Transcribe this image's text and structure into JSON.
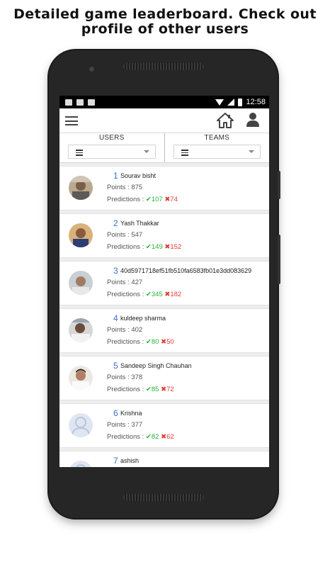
{
  "promo": {
    "line1": "Detailed game leaderboard. Check out",
    "line2": "profile of other users"
  },
  "statusbar": {
    "time": "12:58"
  },
  "filters": {
    "users_label": "USERS",
    "teams_label": "TEAMS"
  },
  "leaderboard": [
    {
      "rank": "1",
      "name": "Sourav bisht",
      "points": "Points : 875",
      "predictions_label": "Predictions :",
      "correct": "107",
      "wrong": "74",
      "avatar": "photo"
    },
    {
      "rank": "2",
      "name": "Yash Thakkar",
      "points": "Points : 547",
      "predictions_label": "Predictions :",
      "correct": "149",
      "wrong": "152",
      "avatar": "photo"
    },
    {
      "rank": "3",
      "name": "40d5971718ef51fb510fa6583fb01e3dd083629",
      "points": "Points : 427",
      "predictions_label": "Predictions :",
      "correct": "345",
      "wrong": "182",
      "avatar": "photo"
    },
    {
      "rank": "4",
      "name": "kuldeep sharma",
      "points": "Points : 402",
      "predictions_label": "Predictions :",
      "correct": "80",
      "wrong": "50",
      "avatar": "photo"
    },
    {
      "rank": "5",
      "name": "Sandeep Singh Chauhan",
      "points": "Points : 378",
      "predictions_label": "Predictions :",
      "correct": "85",
      "wrong": "72",
      "avatar": "photo"
    },
    {
      "rank": "6",
      "name": "Krishna",
      "points": "Points : 377",
      "predictions_label": "Predictions :",
      "correct": "82",
      "wrong": "62",
      "avatar": "placeholder"
    },
    {
      "rank": "7",
      "name": "ashish",
      "points": "",
      "predictions_label": "",
      "correct": "",
      "wrong": "",
      "avatar": "placeholder"
    }
  ],
  "icons": {
    "menu": "hamburger-icon",
    "home": "home-icon",
    "profile": "user-icon",
    "correct": "check-icon",
    "wrong": "cross-icon"
  },
  "colors": {
    "rank": "#3a6fd1",
    "correct": "#27b23a",
    "wrong": "#e23b2f",
    "phone_body": "#262626"
  }
}
